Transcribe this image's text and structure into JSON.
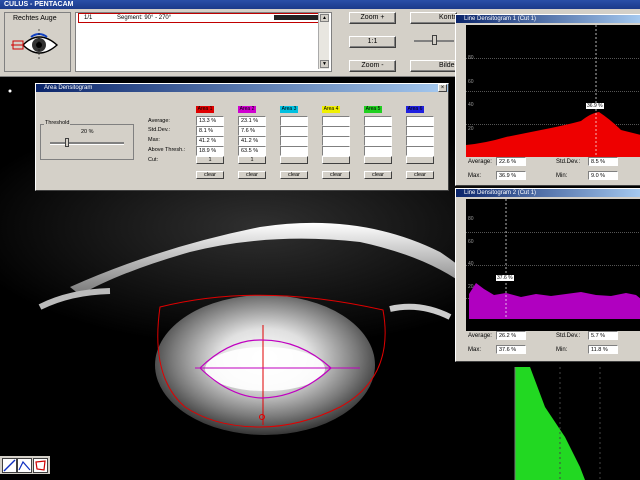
{
  "window": {
    "title": "CULUS - PENTACAM"
  },
  "eye_panel": {
    "label": "Rechtes Auge"
  },
  "segment_list": {
    "index": "1/1",
    "text": "Segment: 90° - 270°"
  },
  "toolbar": {
    "zoom_plus": "Zoom +",
    "one_to_one": "1:1",
    "zoom_minus": "Zoom -",
    "kontrast": "Kontr",
    "bilder": "Bilder"
  },
  "area_window": {
    "title": "Area Densitogram",
    "threshold_label": "Threshold",
    "threshold_value": "20 %",
    "threshold_level": 0.2,
    "row_labels": [
      "Average:",
      "Std.Dev.:",
      "Max:",
      "Above Thresh.:",
      "Cut:"
    ],
    "clear_label": "clear",
    "areas": [
      {
        "name": "Area 1",
        "color": "#e00000",
        "average": "13.3 %",
        "stddev": "8.1 %",
        "max": "41.2 %",
        "above": "18.9 %",
        "cut": "1"
      },
      {
        "name": "Area 2",
        "color": "#d000d0",
        "average": "23.1 %",
        "stddev": "7.6 %",
        "max": "41.2 %",
        "above": "63.5 %",
        "cut": "1"
      },
      {
        "name": "Area 3",
        "color": "#00c0e0",
        "average": "",
        "stddev": "",
        "max": "",
        "above": "",
        "cut": ""
      },
      {
        "name": "Area 4",
        "color": "#f0f000",
        "average": "",
        "stddev": "",
        "max": "",
        "above": "",
        "cut": ""
      },
      {
        "name": "Area 5",
        "color": "#20d020",
        "average": "",
        "stddev": "",
        "max": "",
        "above": "",
        "cut": ""
      },
      {
        "name": "Area 6",
        "color": "#2020e0",
        "average": "",
        "stddev": "",
        "max": "",
        "above": "",
        "cut": ""
      }
    ]
  },
  "line1": {
    "title": "Line Densitogram 1 (Cut 1)",
    "yticks": [
      "80",
      "60",
      "40",
      "20"
    ],
    "peak_label": "36.9 %",
    "stats": {
      "average_label": "Average:",
      "average": "22.6 %",
      "stddev_label": "Std.Dev.:",
      "stddev": "8.5 %",
      "max_label": "Max:",
      "max": "36.9 %",
      "min_label": "Min:",
      "min": "9.0 %"
    },
    "color": "#ee0000"
  },
  "line2": {
    "title": "Line Densitogram 2 (Cut 1)",
    "yticks": [
      "80",
      "60",
      "40",
      "20"
    ],
    "peak_label": "37.6 %",
    "stats": {
      "average_label": "Average:",
      "average": "26.2 %",
      "stddev_label": "Std.Dev.:",
      "stddev": "5.7 %",
      "max_label": "Max:",
      "max": "37.6 %",
      "min_label": "Min:",
      "min": "11.8 %"
    },
    "color": "#b000c0"
  },
  "colors": {
    "ui_gray": "#d4d0c8",
    "title_blue": "#0a246a",
    "green_fill": "#22d822"
  }
}
